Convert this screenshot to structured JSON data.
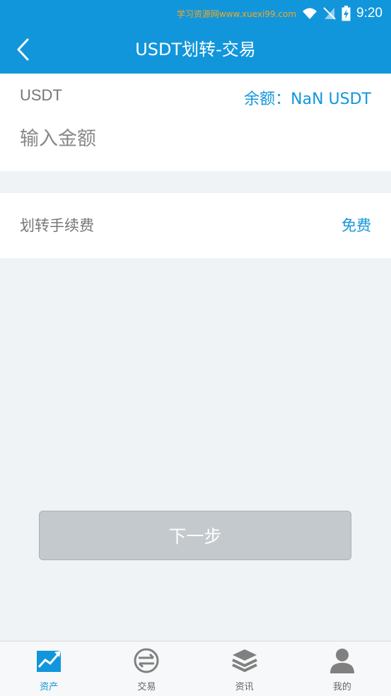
{
  "status_bar": {
    "time": "9:20",
    "watermark": "学习资源网www.xuexi99.com"
  },
  "header": {
    "title": "USDT划转-交易"
  },
  "transfer": {
    "coin": "USDT",
    "balance": "余额：NaN USDT",
    "amount_value": "",
    "amount_placeholder": "输入金额"
  },
  "fee": {
    "label": "划转手续费",
    "value": "免费"
  },
  "next_button": "下一步",
  "tabs": [
    {
      "label": "资产",
      "icon": "chart-trend-icon",
      "active": true
    },
    {
      "label": "交易",
      "icon": "exchange-icon",
      "active": false
    },
    {
      "label": "资讯",
      "icon": "layers-icon",
      "active": false
    },
    {
      "label": "我的",
      "icon": "user-icon",
      "active": false
    }
  ],
  "colors": {
    "accent": "#1296db",
    "button_disabled": "#c4c9cd",
    "background": "#f0f3f5"
  }
}
